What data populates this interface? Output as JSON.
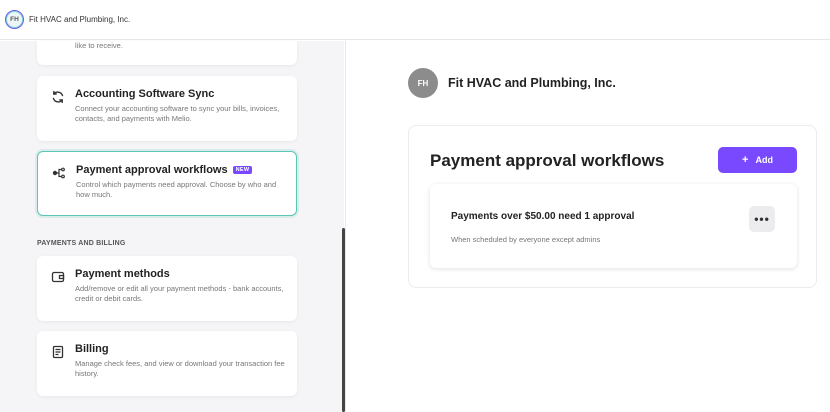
{
  "org": {
    "initials": "FH",
    "name": "Fit HVAC and Plumbing, Inc."
  },
  "sidebar": {
    "partial_card": {
      "description_tail": "like to receive."
    },
    "cards": [
      {
        "id": "accounting",
        "title": "Accounting Software Sync",
        "description": "Connect your accounting software to sync your bills, invoices, contacts, and payments with Melio.",
        "icon": "sync-icon"
      },
      {
        "id": "approval",
        "title": "Payment approval workflows",
        "badge": "NEW",
        "description": "Control which payments need approval. Choose by who and how much.",
        "icon": "workflow-icon",
        "active": true
      }
    ],
    "section_label": "PAYMENTS AND BILLING",
    "billing_cards": [
      {
        "id": "payment-methods",
        "title": "Payment methods",
        "description": "Add/remove or edit all your payment methods - bank accounts, credit or debit cards.",
        "icon": "wallet-icon"
      },
      {
        "id": "billing",
        "title": "Billing",
        "description": "Manage check fees, and view or download your transaction fee history.",
        "icon": "receipt-icon"
      }
    ]
  },
  "main": {
    "company_initials": "FH",
    "company_name": "Fit HVAC and Plumbing, Inc.",
    "panel_title": "Payment approval workflows",
    "add_label": "Add",
    "rule": {
      "title": "Payments over $50.00 need 1 approval",
      "subtitle": "When scheduled by everyone except admins",
      "more_label": "•••"
    }
  },
  "colors": {
    "accent": "#7849ff",
    "active_border": "#5cc7b4"
  }
}
